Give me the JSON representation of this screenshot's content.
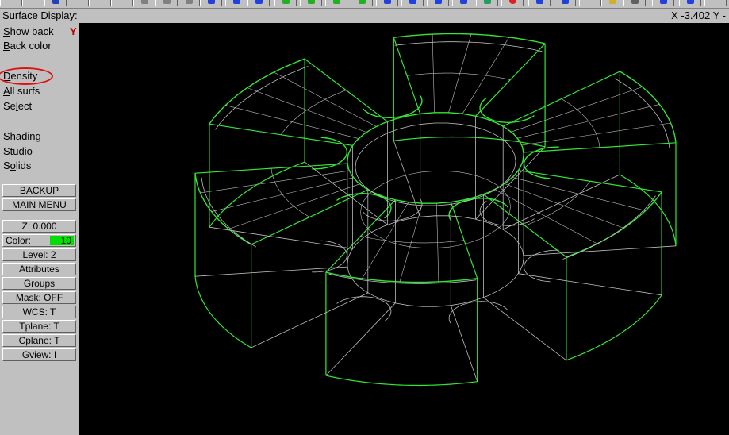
{
  "title": "Surface Display:",
  "coords": "X -3.402  Y -",
  "menu": {
    "show_back": {
      "accel": "S",
      "rest": "how back",
      "value": "Y"
    },
    "back_color": {
      "accel": "B",
      "rest": "ack color"
    },
    "density": {
      "accel": "D",
      "rest": "ensity"
    },
    "all_surfs": {
      "accel": "A",
      "rest": "ll surfs"
    },
    "select": {
      "pre": "Se",
      "accel": "l",
      "rest": "ect"
    },
    "shading": {
      "pre": "S",
      "accel": "h",
      "rest": "ading"
    },
    "studio": {
      "pre": "St",
      "accel": "u",
      "rest": "dio"
    },
    "solids": {
      "pre": "S",
      "accel": "o",
      "rest": "lids"
    }
  },
  "buttons": {
    "backup": "BACKUP",
    "main_menu": "MAIN MENU",
    "z": "Z:   0.000",
    "color_label": "Color:",
    "color_value": "10",
    "level": "Level:  2",
    "attributes": "Attributes",
    "groups": "Groups",
    "mask": "Mask:  OFF",
    "wcs": "WCS:   T",
    "tplane": "Tplane:  T",
    "cplane": "Cplane:  T",
    "gview": "Gview:   I"
  },
  "colors": {
    "wire_green": "#33e633",
    "wire_gray": "#bdbdbd",
    "highlight": "#e01010",
    "color_swatch": "#00e000"
  }
}
